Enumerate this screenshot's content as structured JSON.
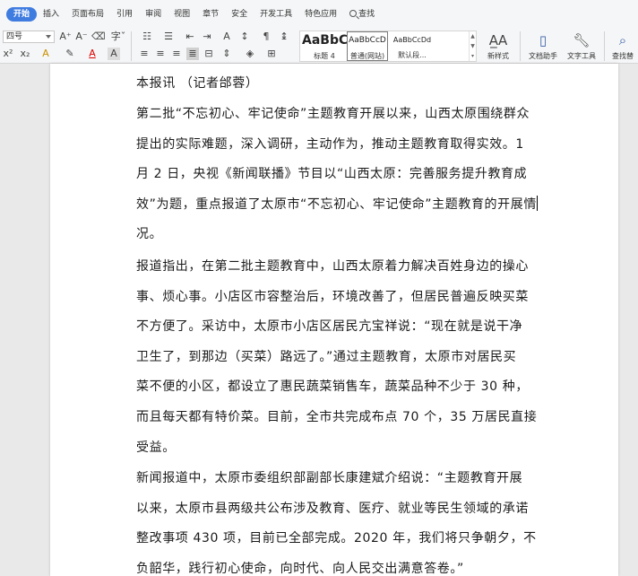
{
  "menu": {
    "tabs": [
      "开始",
      "插入",
      "页面布局",
      "引用",
      "审阅",
      "视图",
      "章节",
      "安全",
      "开发工具",
      "特色应用"
    ],
    "search_label": "查找"
  },
  "ribbon": {
    "font_size_value": "四号",
    "styles": [
      {
        "sample": "AaBbC",
        "label": "标题 4"
      },
      {
        "sample": "AaBbCcD",
        "label": "普通(网站)"
      },
      {
        "sample": "AaBbCcDd",
        "label": "默认段..."
      }
    ],
    "new_style_label": "新样式",
    "doc_helper_label": "文档助手",
    "text_tools_label": "文字工具",
    "find_replace_label": "查找替"
  },
  "document": {
    "paragraphs": [
      {
        "lines": [
          "本报讯  （记者邰蓉）"
        ]
      },
      {
        "lines": [
          "第二批“不忘初心、牢记使命”主题教育开展以来，山西太原围绕群众",
          "提出的实际难题，深入调研，主动作为，推动主题教育取得实效。1",
          "月 2 日，央视《新闻联播》节目以“山西太原：完善服务提升教育成",
          "效”为题，重点报道了太原市“不忘初心、牢记使命”主题教育的开展情",
          "况。"
        ]
      },
      {
        "lines": [
          "报道指出，在第二批主题教育中，山西太原着力解决百姓身边的操心",
          "事、烦心事。小店区市容整治后，环境改善了，但居民普遍反映买菜",
          "不方便了。采访中，太原市小店区居民亢宝祥说：“现在就是说干净",
          "卫生了，到那边（买菜）路远了。”通过主题教育，太原市对居民买",
          "菜不便的小区，都设立了惠民蔬菜销售车，蔬菜品种不少于 30 种，",
          "而且每天都有特价菜。目前，全市共完成布点 70 个，35 万居民直接",
          "受益。"
        ]
      },
      {
        "lines": [
          "新闻报道中，太原市委组织部副部长康建斌介绍说：“主题教育开展",
          "以来，太原市县两级共公布涉及教育、医疗、就业等民生领域的承诺",
          "整改事项 430 项，目前已全部完成。2020 年，我们将只争朝夕，不",
          "负韶华，践行初心使命，向时代、向人民交出满意答卷。”"
        ]
      }
    ]
  }
}
